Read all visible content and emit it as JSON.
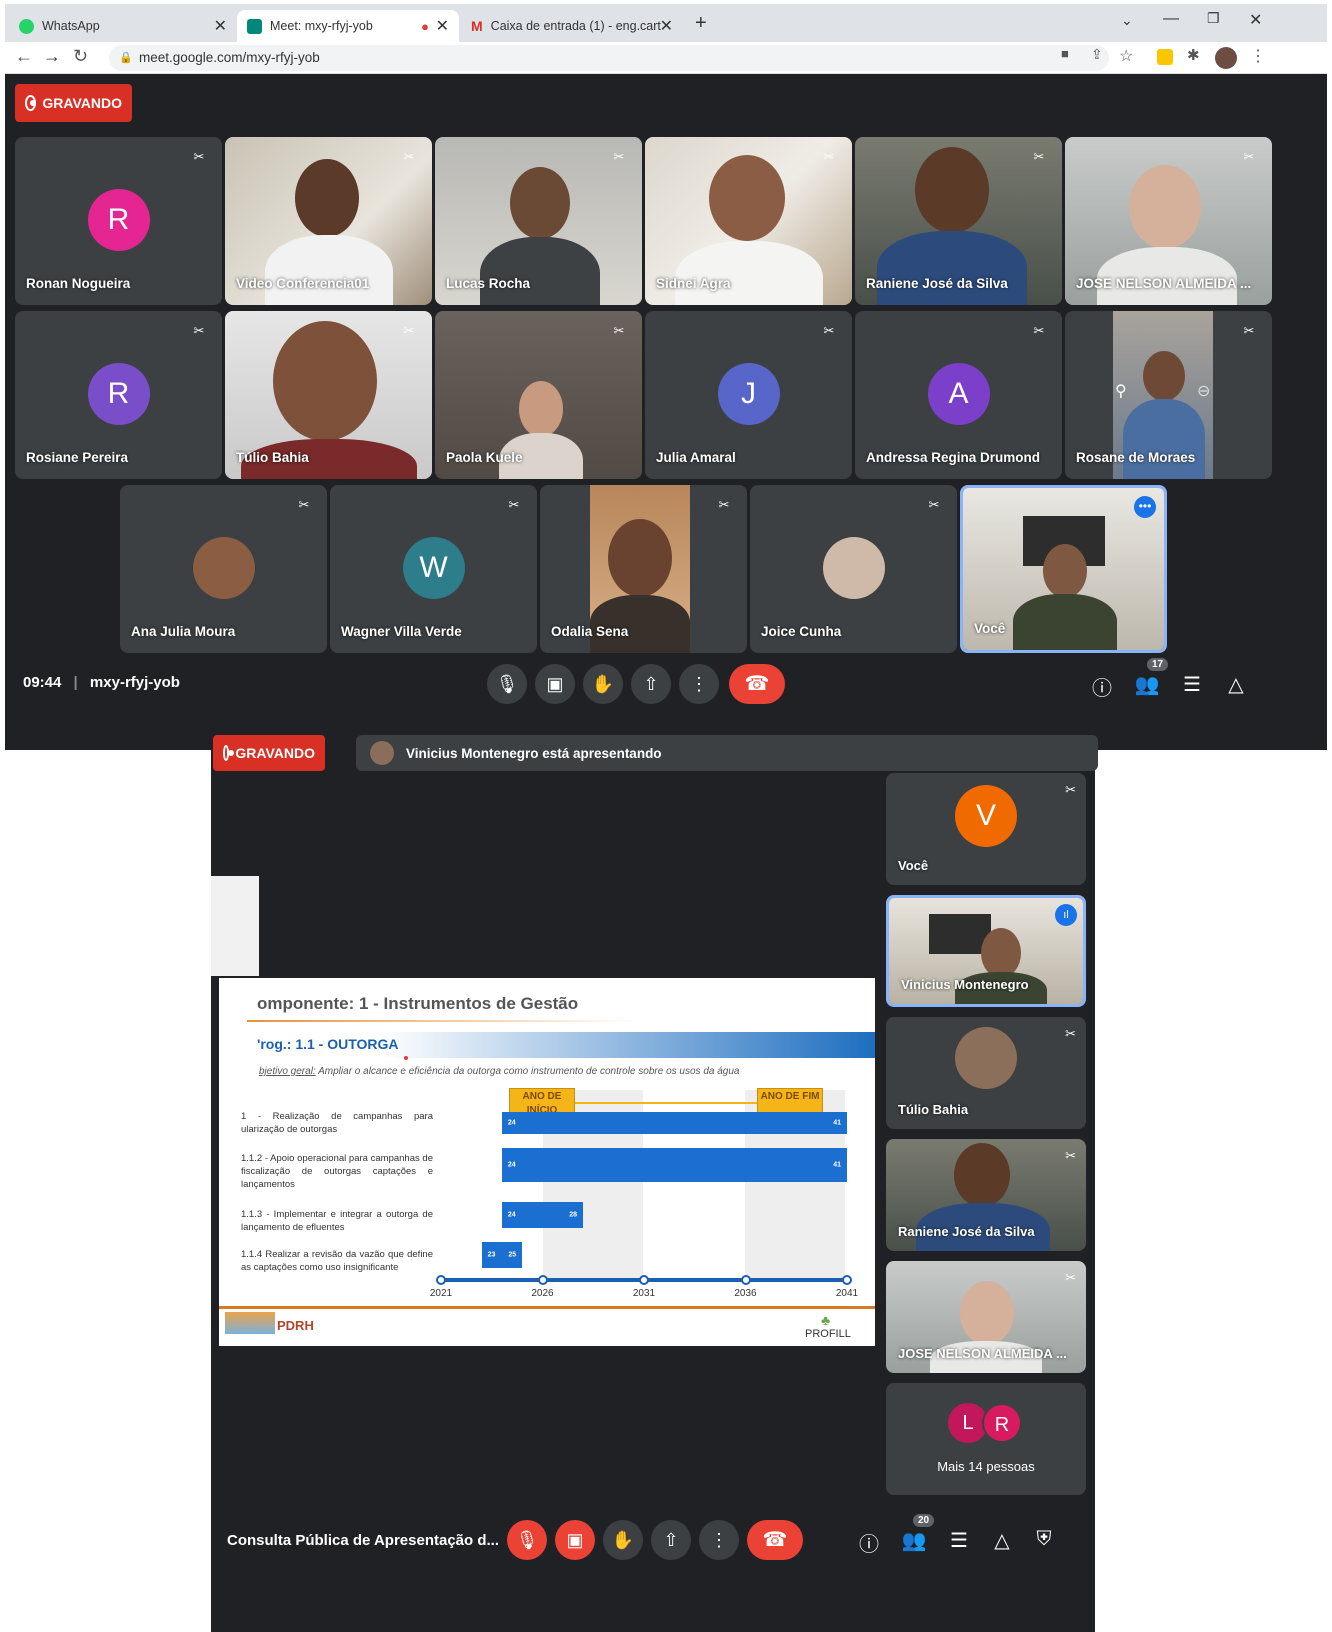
{
  "browser": {
    "tabs": [
      {
        "label": "WhatsApp"
      },
      {
        "label": "Meet: mxy-rfyj-yob"
      },
      {
        "label": "Caixa de entrada (1) - eng.cart.m"
      }
    ],
    "url": "meet.google.com/mxy-rfyj-yob"
  },
  "meet1": {
    "recording_label": "GRAVANDO",
    "time": "09:44",
    "separator": "|",
    "meeting_code": "mxy-rfyj-yob",
    "participant_count": "17",
    "participants": [
      {
        "name": "Ronan Nogueira",
        "initial": "R",
        "color": "#e52592"
      },
      {
        "name": "Video Conferencia01"
      },
      {
        "name": "Lucas Rocha"
      },
      {
        "name": "Sidnei Agra"
      },
      {
        "name": "Raniene José da Silva"
      },
      {
        "name": "JOSE NELSON ALMEIDA ..."
      },
      {
        "name": "Rosiane Pereira",
        "initial": "R",
        "color": "#7b4ec9"
      },
      {
        "name": "Túlio Bahia"
      },
      {
        "name": "Paola Kuele"
      },
      {
        "name": "Julia Amaral",
        "initial": "J",
        "color": "#5865c9"
      },
      {
        "name": "Andressa Regina Drumond",
        "initial": "A",
        "color": "#7b3fc9"
      },
      {
        "name": "Rosane de Moraes"
      },
      {
        "name": "Ana Julia Moura"
      },
      {
        "name": "Wagner Villa Verde",
        "initial": "W",
        "color": "#2e7d8a"
      },
      {
        "name": "Odalia Sena"
      },
      {
        "name": "Joice Cunha"
      },
      {
        "name": "Você"
      }
    ]
  },
  "meet2": {
    "recording_label": "GRAVANDO",
    "presenting_banner": "Vinicius Montenegro está apresentando",
    "meeting_title": "Consulta Pública de Apresentação d...",
    "participant_count": "20",
    "sidebar": [
      {
        "name": "Você",
        "initial": "V",
        "color": "#f06a00"
      },
      {
        "name": "Vinicius Montenegro"
      },
      {
        "name": "Túlio Bahia"
      },
      {
        "name": "Raniene José da Silva"
      },
      {
        "name": "JOSE NELSON ALMEIDA ..."
      }
    ],
    "more_people": {
      "label": "Mais 14 pessoas",
      "initials": [
        "L",
        "R"
      ]
    }
  },
  "slide": {
    "title": "omponente: 1 - Instrumentos de Gestão",
    "program": "'rog.: 1.1 - OUTORGA",
    "objective_label": "bjetivo geral:",
    "objective_text": "Ampliar o alcance e eficiência da outorga como instrumento de controle sobre os usos da água",
    "start_label": "ANO DE INÍCIO",
    "end_label": "ANO DE FIM",
    "footer_left": "PDRH",
    "footer_right": "PROFILL",
    "tasks": [
      {
        "label": "1 - Realização de campanhas para ularização de outorgas",
        "start": "24",
        "end": "41"
      },
      {
        "label": "1.1.2 - Apoio operacional para campanhas de fiscalização de outorgas captações e lançamentos",
        "start": "24",
        "end": "41"
      },
      {
        "label": "1.1.3 - Implementar e integrar a outorga de lançamento de efluentes",
        "start": "24",
        "end": "28"
      },
      {
        "label": "1.1.4 Realizar a revisão da vazão que define as captações como uso insignificante",
        "start": "23",
        "end": "25"
      }
    ],
    "years": [
      "2021",
      "2026",
      "2031",
      "2036",
      "2041"
    ]
  }
}
